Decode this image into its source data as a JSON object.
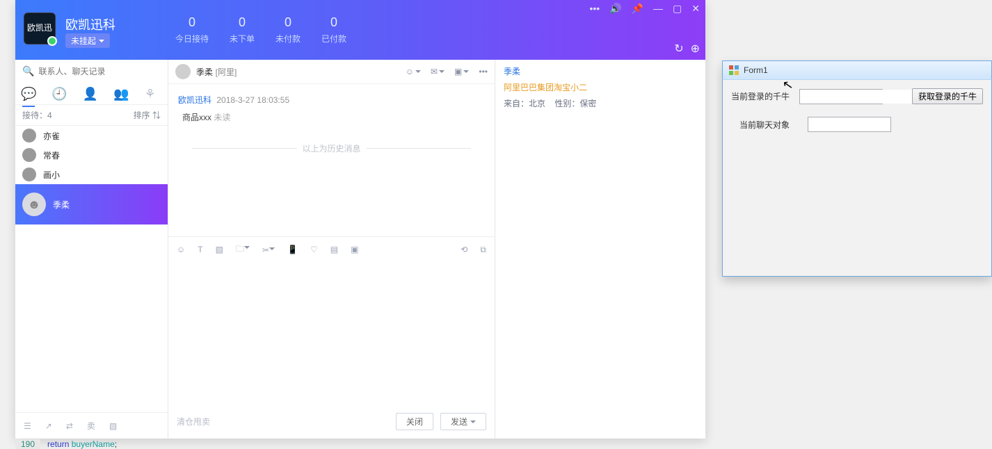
{
  "header": {
    "brand": "欧凯迅科",
    "logo_text": "欧凯迅",
    "status": "未挂起",
    "stats": [
      {
        "n": "0",
        "l": "今日接待"
      },
      {
        "n": "0",
        "l": "未下单"
      },
      {
        "n": "0",
        "l": "未付款"
      },
      {
        "n": "0",
        "l": "已付款"
      }
    ],
    "win": {
      "more": "•••",
      "sound": "🔊",
      "pin": "📌",
      "min": "—",
      "max": "▢",
      "close": "✕"
    },
    "tray": {
      "reload": "↻",
      "plus": "⊕"
    }
  },
  "sidebar": {
    "search_placeholder": "联系人、聊天记录",
    "receive_label": "接待：4",
    "sort_label": "排序 ⇅",
    "contacts": [
      {
        "name": "亦雀"
      },
      {
        "name": "常春"
      },
      {
        "name": "画小"
      },
      {
        "name": "季柔"
      }
    ],
    "bottom": {
      "menu": "☰",
      "out": "↗",
      "transfer": "⇄",
      "sell": "卖",
      "multi": "▧"
    }
  },
  "chat": {
    "title_name": "季柔",
    "title_tag": "[阿里]",
    "head_icons": {
      "bubble": "☺",
      "mail": "✉",
      "video": "▣",
      "more": "•••"
    },
    "msg_author": "欧凯迅科",
    "msg_time": "2018-3-27 18:03:55",
    "msg_text": "商品xxx",
    "msg_status": "未读",
    "history_divider": "以上为历史消息",
    "editor_icons": {
      "emoji": "☺",
      "text": "T",
      "pic": "▧",
      "folder": "🗀",
      "cut": "✂",
      "phone": "📱",
      "heart": "♡",
      "calc": "▤",
      "clip": "▣",
      "quick": "⟲",
      "cart": "⧉"
    },
    "ghost_link": "清仓甩卖",
    "close_btn": "关闭",
    "send_btn": "发送"
  },
  "detail": {
    "name": "季柔",
    "org": "阿里巴巴集团淘宝小二",
    "from_label": "来自：",
    "from_value": "北京",
    "gender_label": "性别：",
    "gender_value": "保密"
  },
  "form1": {
    "title": "Form1",
    "row1_label": "当前登录的千牛",
    "row1_value": "",
    "row1_button": "获取登录的千牛",
    "row2_label": "当前聊天对象",
    "row2_value": ""
  },
  "code": {
    "line_no": "190",
    "kw1": "return",
    "ident": "buyerName",
    "semi": ";"
  }
}
